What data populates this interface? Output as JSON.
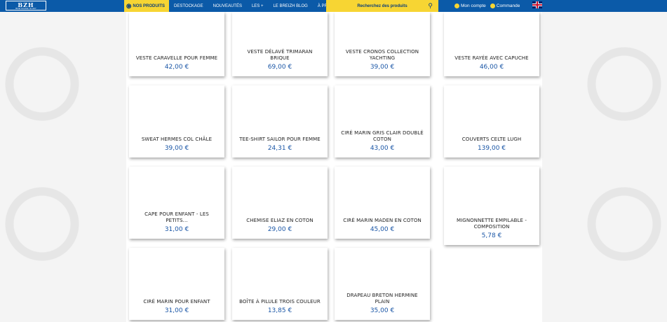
{
  "header": {
    "logo_main": "BZH",
    "logo_sub": "BRETAGNE SHOP",
    "nav": [
      {
        "label": "NOS PRODUITS",
        "icon": "triskel-icon"
      },
      {
        "label": "DESTOCKAGE"
      },
      {
        "label": "NOUVEAUTÉS"
      },
      {
        "label": "LES +"
      },
      {
        "label": "LE BREIZH BLOG"
      },
      {
        "label": "À PROPOS"
      }
    ],
    "search_placeholder": "Recherchez des produits",
    "account_label": "Mon compte",
    "order_label": "Commande",
    "language_flag": "uk-flag-icon"
  },
  "colors": {
    "nav_bg": "#0b5aa8",
    "accent_yellow": "#f7d533",
    "price_blue": "#1a56a6"
  },
  "products": [
    {
      "name": "VESTE CARAVELLE POUR FEMME",
      "price": "42,00 €"
    },
    {
      "name": "VESTE DÉLAVÉ TRIMARAN BRIQUE",
      "price": "69,00 €"
    },
    {
      "name": "VESTE CRONOS COLLECTION YACHTING",
      "price": "39,00 €"
    },
    {
      "name": "VESTE RAYÉE AVEC CAPUCHE",
      "price": "46,00 €"
    },
    {
      "name": "SWEAT HERMES COL CHÂLE",
      "price": "39,00 €"
    },
    {
      "name": "TEE-SHIRT SAILOR POUR FEMME",
      "price": "24,31 €"
    },
    {
      "name": "CIRÉ MARIN GRIS CLAIR DOUBLÉ COTON",
      "price": "43,00 €"
    },
    {
      "name": "COUVERTS CELTE LUGH",
      "price": "139,00 €"
    },
    {
      "name": "CAPE POUR ENFANT - LES PETITS...",
      "price": "31,00 €"
    },
    {
      "name": "CHEMISE ELIAZ EN COTON",
      "price": "29,00 €"
    },
    {
      "name": "CIRÉ MARIN MADEN EN COTON",
      "price": "45,00 €"
    },
    {
      "name": "MIGNONNETTE EMPILABLE - COMPOSITION",
      "price": "5,78 €"
    },
    {
      "name": "CIRÉ MARIN POUR ENFANT",
      "price": "31,00 €"
    },
    {
      "name": "BOÎTE À PILULE TROIS COULEUR",
      "price": "13,85 €"
    },
    {
      "name": "DRAPEAU BRETON HERMINE PLAIN",
      "price": "35,00 €"
    }
  ]
}
